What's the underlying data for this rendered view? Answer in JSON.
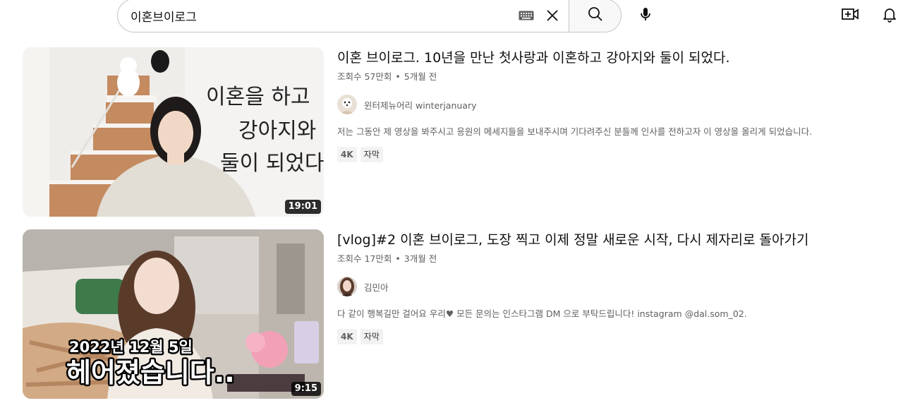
{
  "search": {
    "query": "이혼브이로그"
  },
  "icons": {
    "keyboard": "keyboard-icon",
    "clear": "close-icon",
    "search": "search-icon",
    "mic": "mic-icon",
    "create": "video-add-icon",
    "notifications": "bell-icon"
  },
  "results": [
    {
      "title": "이혼 브이로그. 10년을 만난 첫사랑과 이혼하고 강아지와 둘이 되었다.",
      "views": "조회수 57만회",
      "age": "5개월 전",
      "channel": "윈터제뉴어리 winterjanuary",
      "description": "저는 그동안 제 영상을 봐주시고 응원의 메세지들을 보내주시며 기다려주신 분들께 인사를 전하고자 이 영상을 올리게 되었습니다.",
      "badges": [
        "4K",
        "자막"
      ],
      "duration": "19:01",
      "thumb_text": [
        "이혼을 하고",
        "강아지와",
        "둘이 되었다"
      ]
    },
    {
      "title": "[vlog]#2 이혼 브이로그, 도장 찍고 이제 정말 새로운 시작, 다시 제자리로 돌아가기",
      "views": "조회수 17만회",
      "age": "3개월 전",
      "channel": "김민아",
      "description": "다 같이 행복길만 걸어요 우리♥ 모든 문의는 인스타그램 DM 으로 부탁드립니다! instagram @dal.som_02.",
      "badges": [
        "4K",
        "자막"
      ],
      "duration": "9:15",
      "thumb_text": [
        "2022년 12월 5일",
        "헤어졌습니다.."
      ]
    }
  ],
  "separator": "•"
}
